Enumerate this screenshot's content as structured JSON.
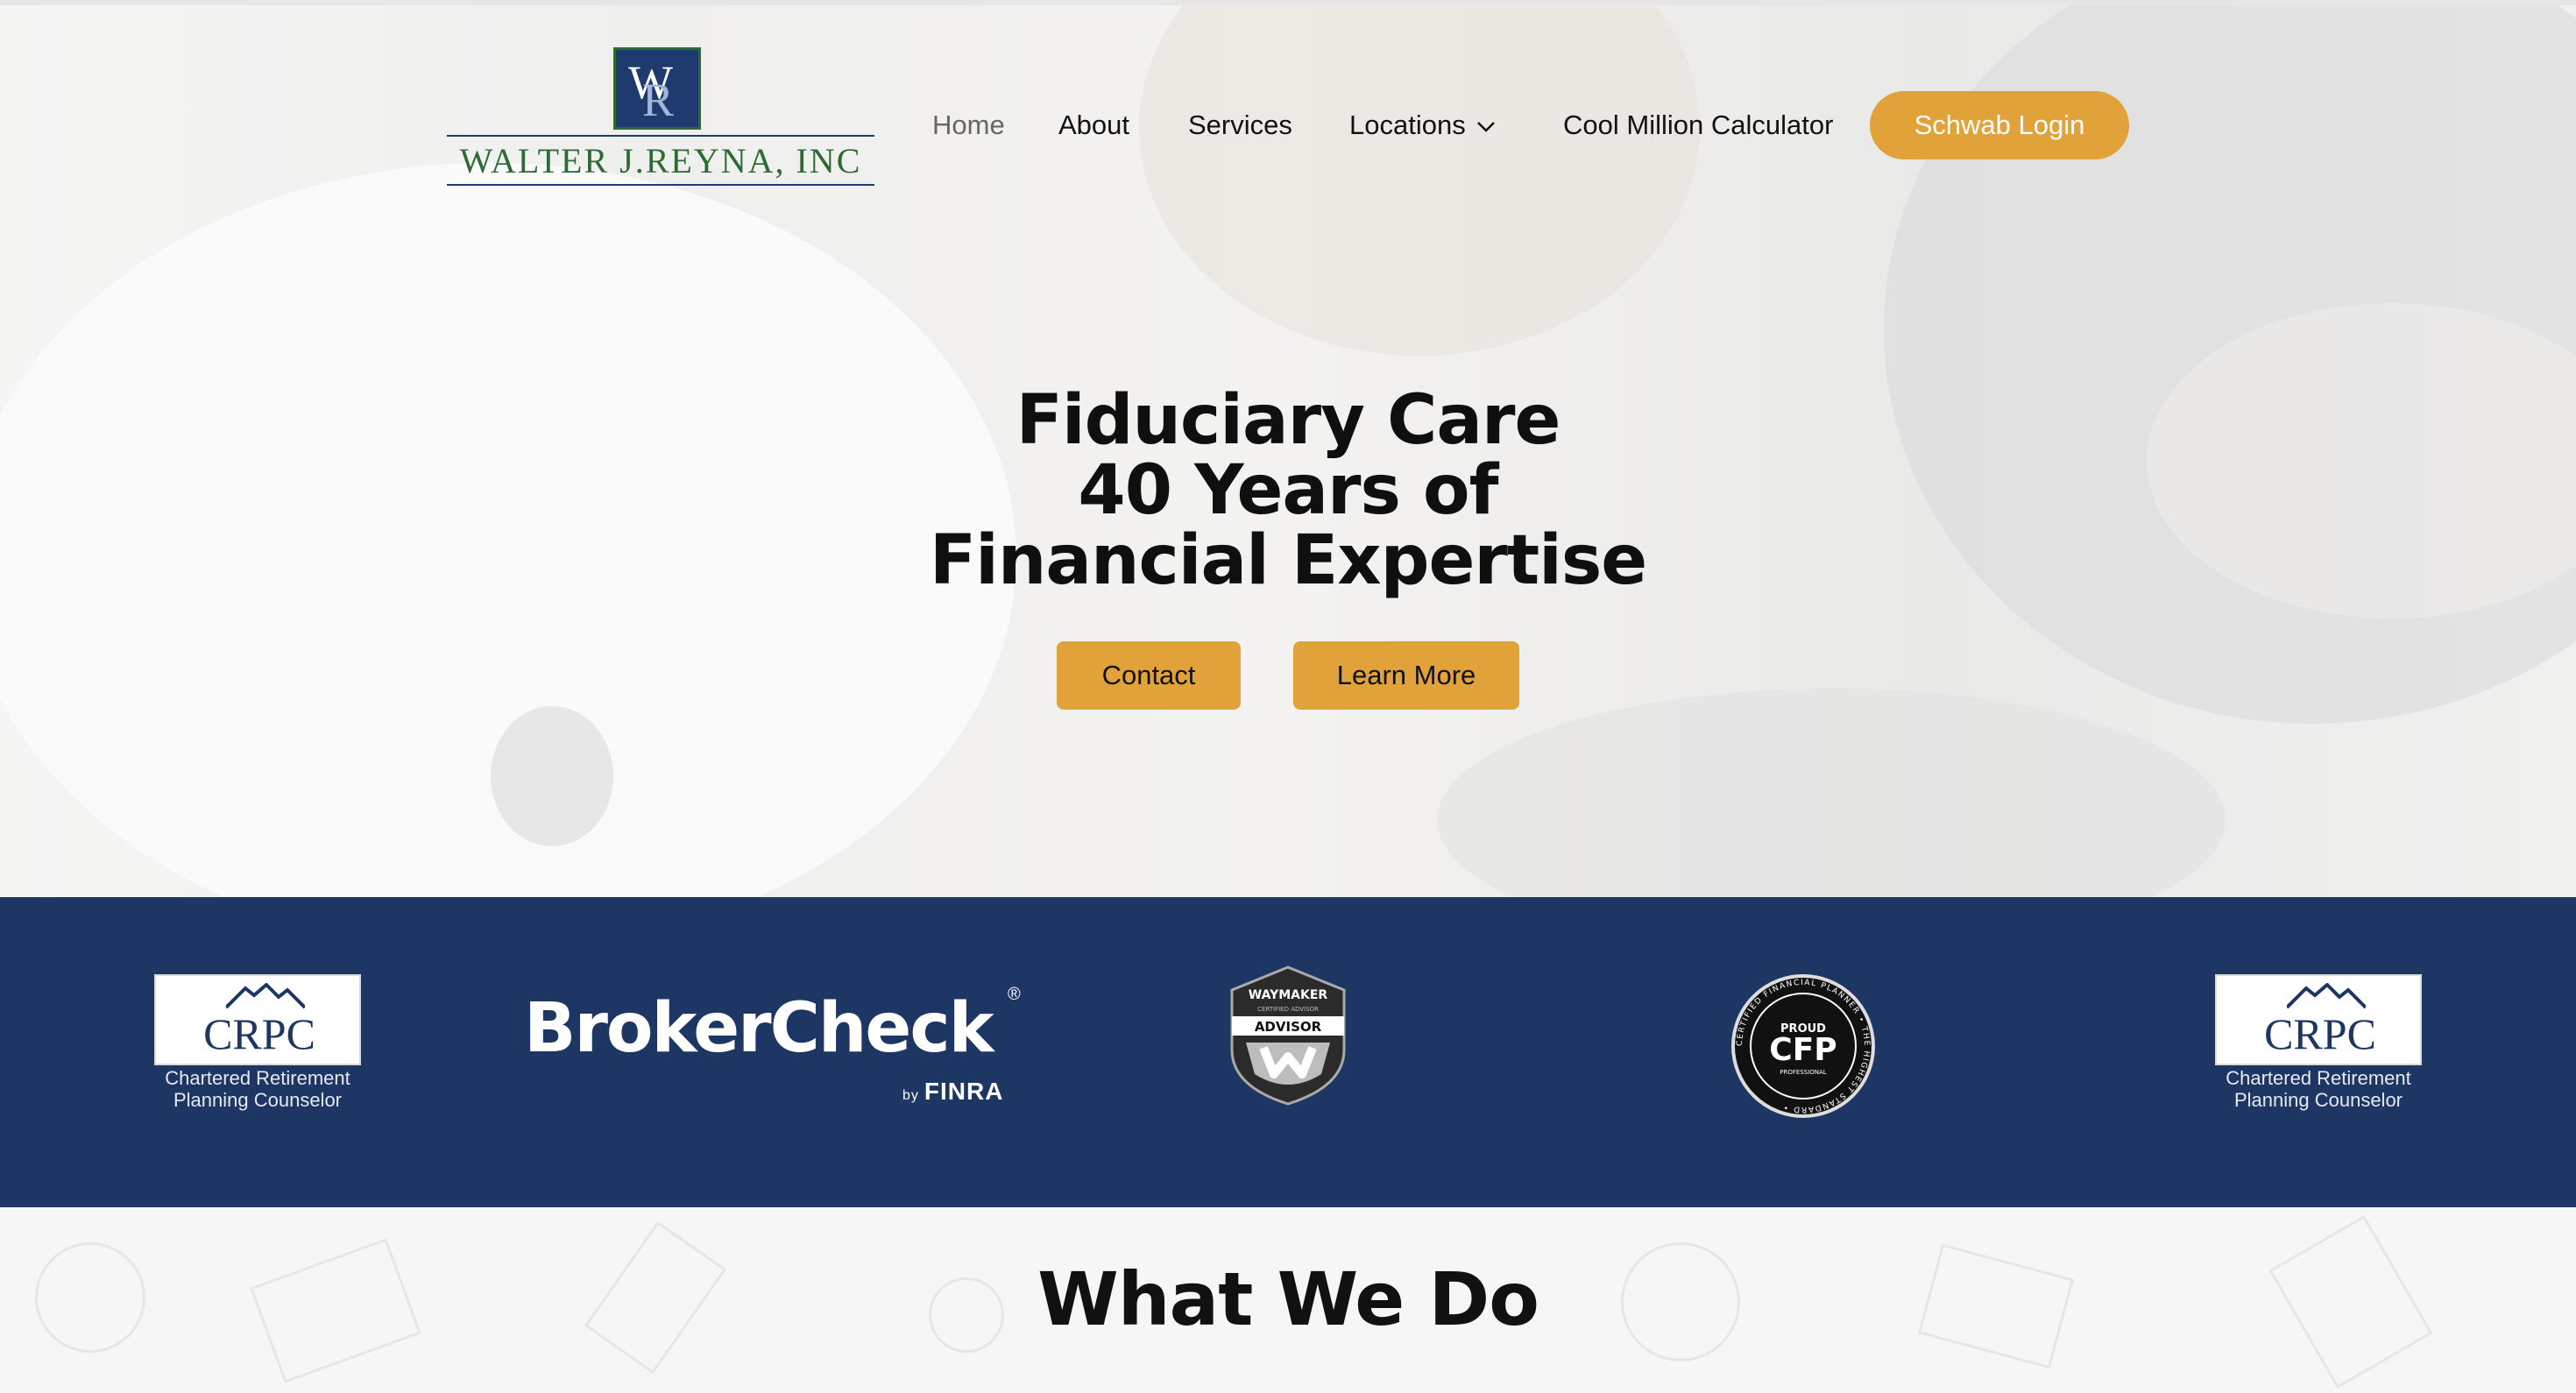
{
  "header": {
    "logo_text": "WALTER J.REYNA, INC",
    "logo_mark_text": "WR",
    "nav": [
      {
        "label": "Home"
      },
      {
        "label": "About"
      },
      {
        "label": "Services"
      },
      {
        "label": "Locations"
      },
      {
        "label": "Cool Million Calculator"
      }
    ],
    "login_label": "Schwab Login"
  },
  "hero": {
    "title_lines": [
      "Fiduciary Care",
      "40 Years of",
      "Financial Expertise"
    ],
    "contact_label": "Contact",
    "learn_more_label": "Learn More"
  },
  "badges": {
    "crpc_word": "CRPC",
    "crpc_sub_1": "Chartered Retirement",
    "crpc_sub_2": "Planning Counselor",
    "brokercheck_name": "BrokerCheck",
    "brokercheck_by": "by",
    "brokercheck_org": "FINRA",
    "waymaker_top": "WAYMAKER",
    "waymaker_sub": "CERTIFIED ADVISOR",
    "waymaker_label": "ADVISOR",
    "cfp_proud": "PROUD",
    "cfp_mark": "CFP",
    "cfp_pro": "PROFESSIONAL",
    "cfp_ring": "CERTIFIED FINANCIAL PLANNER • THE HIGHEST STANDARD •"
  },
  "section": {
    "heading": "What We Do"
  },
  "colors": {
    "accent": "#e1a23a",
    "navy": "#1e3664",
    "logo_green": "#2e6b34"
  }
}
